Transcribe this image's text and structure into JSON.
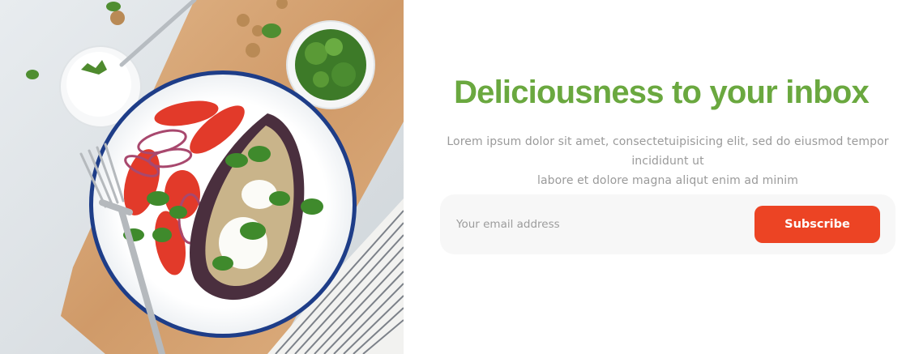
{
  "newsletter": {
    "headline": "Deliciousness to your inbox",
    "description_line1": "Lorem ipsum dolor sit amet, consectetuipisicing elit, sed do eiusmod tempor incididunt ut",
    "description_line2": "labore et dolore magna aliqut enim ad minim",
    "email_placeholder": "Your email address",
    "email_value": "",
    "subscribe_label": "Subscribe"
  },
  "colors": {
    "headline": "#6aa83f",
    "button": "#ec4424",
    "form_background": "#f7f7f7",
    "description_text": "#9a9a9a"
  },
  "image": {
    "subject": "plate-of-roasted-eggplant-salad"
  }
}
